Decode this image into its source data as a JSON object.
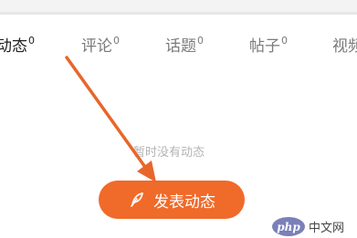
{
  "tabs": [
    {
      "label": "动态",
      "count": "0",
      "active": true
    },
    {
      "label": "评论",
      "count": "0",
      "active": false
    },
    {
      "label": "话题",
      "count": "0",
      "active": false
    },
    {
      "label": "帖子",
      "count": "0",
      "active": false
    },
    {
      "label": "视频",
      "count": "",
      "active": false
    }
  ],
  "empty_state": {
    "text": "暂时没有动态"
  },
  "post_button": {
    "label": "发表动态",
    "icon": "feather-pen-icon",
    "color": "#f06a2a"
  },
  "annotation": {
    "arrow_color": "#e8662a"
  },
  "watermark": {
    "logo_text": "php",
    "text": "中文网"
  }
}
